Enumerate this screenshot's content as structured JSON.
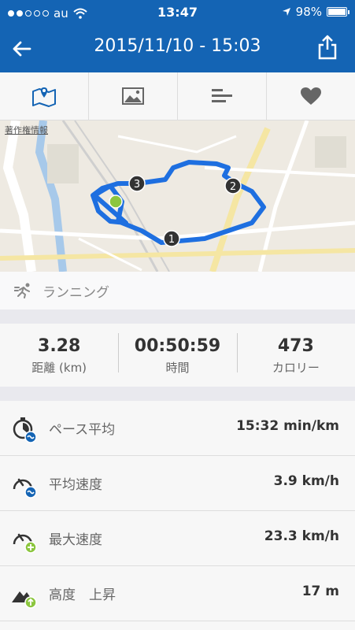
{
  "status_bar": {
    "carrier": "au",
    "time": "13:47",
    "battery": "98%",
    "battery_level": 0.98
  },
  "nav": {
    "title": "2015/11/10 - 15:03"
  },
  "tabs": [
    "map-pin-icon",
    "image-icon",
    "bars-icon",
    "heart-icon"
  ],
  "map": {
    "copyright": "著作権情報",
    "markers": [
      "1",
      "2",
      "3"
    ]
  },
  "activity": {
    "label": "ランニング"
  },
  "summary": [
    {
      "value": "3.28",
      "unit": "距離 (km)"
    },
    {
      "value": "00:50:59",
      "unit": "時間"
    },
    {
      "value": "473",
      "unit": "カロリー"
    }
  ],
  "rows": [
    {
      "label": "ペース平均",
      "value": "15:32 min/km",
      "icon": "pace-average-icon"
    },
    {
      "label": "平均速度",
      "value": "3.9 km/h",
      "icon": "average-speed-icon"
    },
    {
      "label": "最大速度",
      "value": "23.3 km/h",
      "icon": "max-speed-icon"
    },
    {
      "label": "高度　上昇",
      "value": "17 m",
      "icon": "elevation-gain-icon"
    }
  ],
  "colors": {
    "brand": "#1464b4",
    "route": "#1e6fe0",
    "green": "#8cc63f"
  }
}
